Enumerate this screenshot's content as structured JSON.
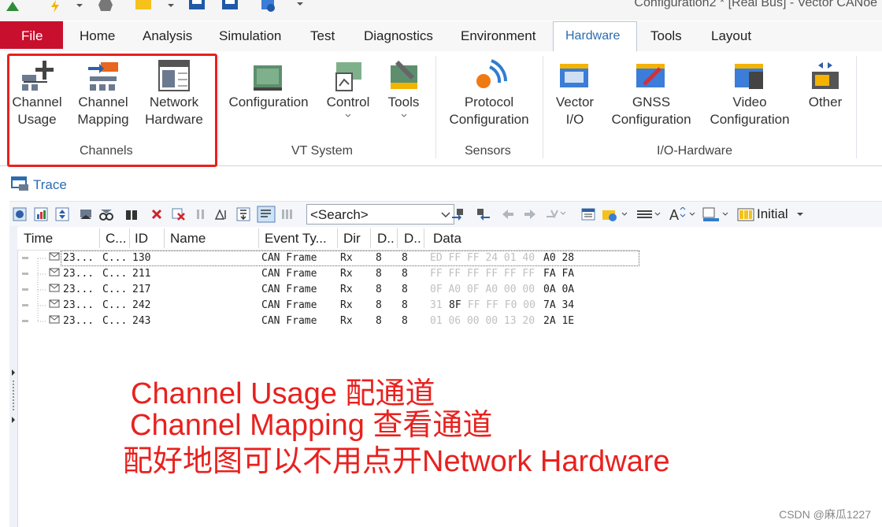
{
  "window": {
    "title": "Configuration2 * [Real Bus] - Vector CANoe"
  },
  "menu": {
    "file": "File",
    "tabs": [
      "Home",
      "Analysis",
      "Simulation",
      "Test",
      "Diagnostics",
      "Environment",
      "Hardware",
      "Tools",
      "Layout"
    ],
    "active": "Hardware"
  },
  "ribbon": {
    "channel_usage": "Channel\nUsage",
    "channel_mapping": "Channel\nMapping",
    "network_hardware": "Network\nHardware",
    "channels_group": "Channels",
    "configuration": "Configuration",
    "control": "Control",
    "tools": "Tools",
    "vt_group": "VT System",
    "protocol_configuration": "Protocol\nConfiguration",
    "sensors_group": "Sensors",
    "vector_io": "Vector\nI/O",
    "gnss_configuration": "GNSS\nConfiguration",
    "video_configuration": "Video\nConfiguration",
    "other": "Other",
    "io_group": "I/O-Hardware"
  },
  "trace": {
    "title": "Trace",
    "search_placeholder": "<Search>",
    "view_label": "Initial",
    "columns": [
      "Time",
      "C...",
      "ID",
      "Name",
      "Event Ty...",
      "Dir",
      "D..",
      "D..",
      "Data"
    ],
    "rows": [
      {
        "time": "23...",
        "chn": "C...",
        "id": "130",
        "name": "",
        "type": "CAN Frame",
        "dir": "Rx",
        "dlc": "8",
        "len": "8",
        "faint": "ED FF FF 24 01 40",
        "data": "A0 28"
      },
      {
        "time": "23...",
        "chn": "C...",
        "id": "211",
        "name": "",
        "type": "CAN Frame",
        "dir": "Rx",
        "dlc": "8",
        "len": "8",
        "faint": "FF FF FF FF FF FF",
        "data": "FA FA"
      },
      {
        "time": "23...",
        "chn": "C...",
        "id": "217",
        "name": "",
        "type": "CAN Frame",
        "dir": "Rx",
        "dlc": "8",
        "len": "8",
        "faint": "0F A0 0F A0 00 00",
        "data": "0A 0A"
      },
      {
        "time": "23...",
        "chn": "C...",
        "id": "242",
        "name": "",
        "type": "CAN Frame",
        "dir": "Rx",
        "dlc": "8",
        "len": "8",
        "faint_pre": "31 ",
        "dark_mid": "8F",
        "faint": " FF FF F0 00",
        "data": "7A 34"
      },
      {
        "time": "23...",
        "chn": "C...",
        "id": "243",
        "name": "",
        "type": "CAN Frame",
        "dir": "Rx",
        "dlc": "8",
        "len": "8",
        "faint": "01 06 00 00 13 20",
        "data": "2A 1E"
      }
    ]
  },
  "annotations": {
    "line1": "Channel Usage 配通道",
    "line2": "Channel Mapping 查看通道",
    "line3": "配好地图可以不用点开Network Hardware"
  },
  "watermark": "CSDN @麻瓜1227",
  "colors": {
    "accent": "#2b6cb0",
    "file_tab": "#c8102e",
    "annotation": "#e8211e"
  }
}
